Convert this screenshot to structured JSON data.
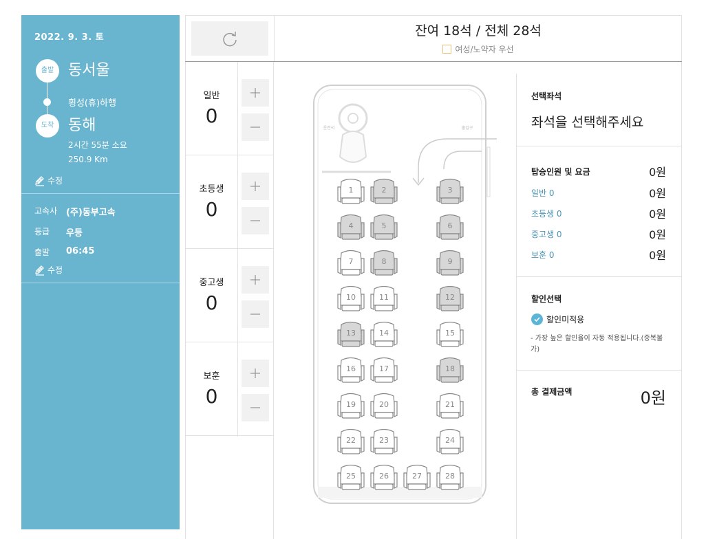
{
  "sidebar": {
    "date": "2022. 9. 3. 토",
    "departure_badge": "출발",
    "departure": "동서울",
    "via": "횡성(휴)하행",
    "arrival_badge": "도착",
    "arrival": "동해",
    "duration": "2시간 55분 소요",
    "distance": "250.9 Km",
    "edit_label": "수정",
    "company_key": "고속사",
    "company": "(주)동부고속",
    "grade_key": "등급",
    "grade": "우등",
    "depart_time_key": "출발",
    "depart_time": "06:45",
    "edit_label_2": "수정"
  },
  "header": {
    "seat_status": "잔여 18석 / 전체 28석",
    "legend": "여성/노약자 우선"
  },
  "passengers": [
    {
      "label": "일반",
      "count": "0"
    },
    {
      "label": "초등생",
      "count": "0"
    },
    {
      "label": "중고생",
      "count": "0"
    },
    {
      "label": "보훈",
      "count": "0"
    }
  ],
  "bus": {
    "driver_label": "운전석",
    "door_label": "출입구",
    "seats": [
      {
        "n": "1",
        "taken": false
      },
      {
        "n": "2",
        "taken": true
      },
      {
        "n": "3",
        "taken": true
      },
      {
        "n": "4",
        "taken": true
      },
      {
        "n": "5",
        "taken": true
      },
      {
        "n": "6",
        "taken": true
      },
      {
        "n": "7",
        "taken": false
      },
      {
        "n": "8",
        "taken": true
      },
      {
        "n": "9",
        "taken": true
      },
      {
        "n": "10",
        "taken": false
      },
      {
        "n": "11",
        "taken": false
      },
      {
        "n": "12",
        "taken": true
      },
      {
        "n": "13",
        "taken": true
      },
      {
        "n": "14",
        "taken": false
      },
      {
        "n": "15",
        "taken": false
      },
      {
        "n": "16",
        "taken": false
      },
      {
        "n": "17",
        "taken": false
      },
      {
        "n": "18",
        "taken": true
      },
      {
        "n": "19",
        "taken": false
      },
      {
        "n": "20",
        "taken": false
      },
      {
        "n": "21",
        "taken": false
      },
      {
        "n": "22",
        "taken": false
      },
      {
        "n": "23",
        "taken": false
      },
      {
        "n": "24",
        "taken": false
      },
      {
        "n": "25",
        "taken": false
      },
      {
        "n": "26",
        "taken": false
      },
      {
        "n": "27",
        "taken": false
      },
      {
        "n": "28",
        "taken": false
      }
    ]
  },
  "summary": {
    "selected_title": "선택좌석",
    "selected_prompt": "좌석을 선택해주세요",
    "fare_title": "탑승인원 및 요금",
    "fare_total": "0원",
    "fares": [
      {
        "label": "일반 0",
        "amount": "0원"
      },
      {
        "label": "초등생 0",
        "amount": "0원"
      },
      {
        "label": "중고생 0",
        "amount": "0원"
      },
      {
        "label": "보훈 0",
        "amount": "0원"
      }
    ],
    "discount_title": "할인선택",
    "discount_option": "할인미적용",
    "discount_note": "- 가장 높은 할인율이 자동 적용됩니다.(중복불가)",
    "total_label": "총 결제금액",
    "total_amount": "0원"
  },
  "colors": {
    "sidebar_bg": "#69b4cf",
    "taken_seat": "#d7d7d7",
    "accent": "#4d95b5"
  }
}
